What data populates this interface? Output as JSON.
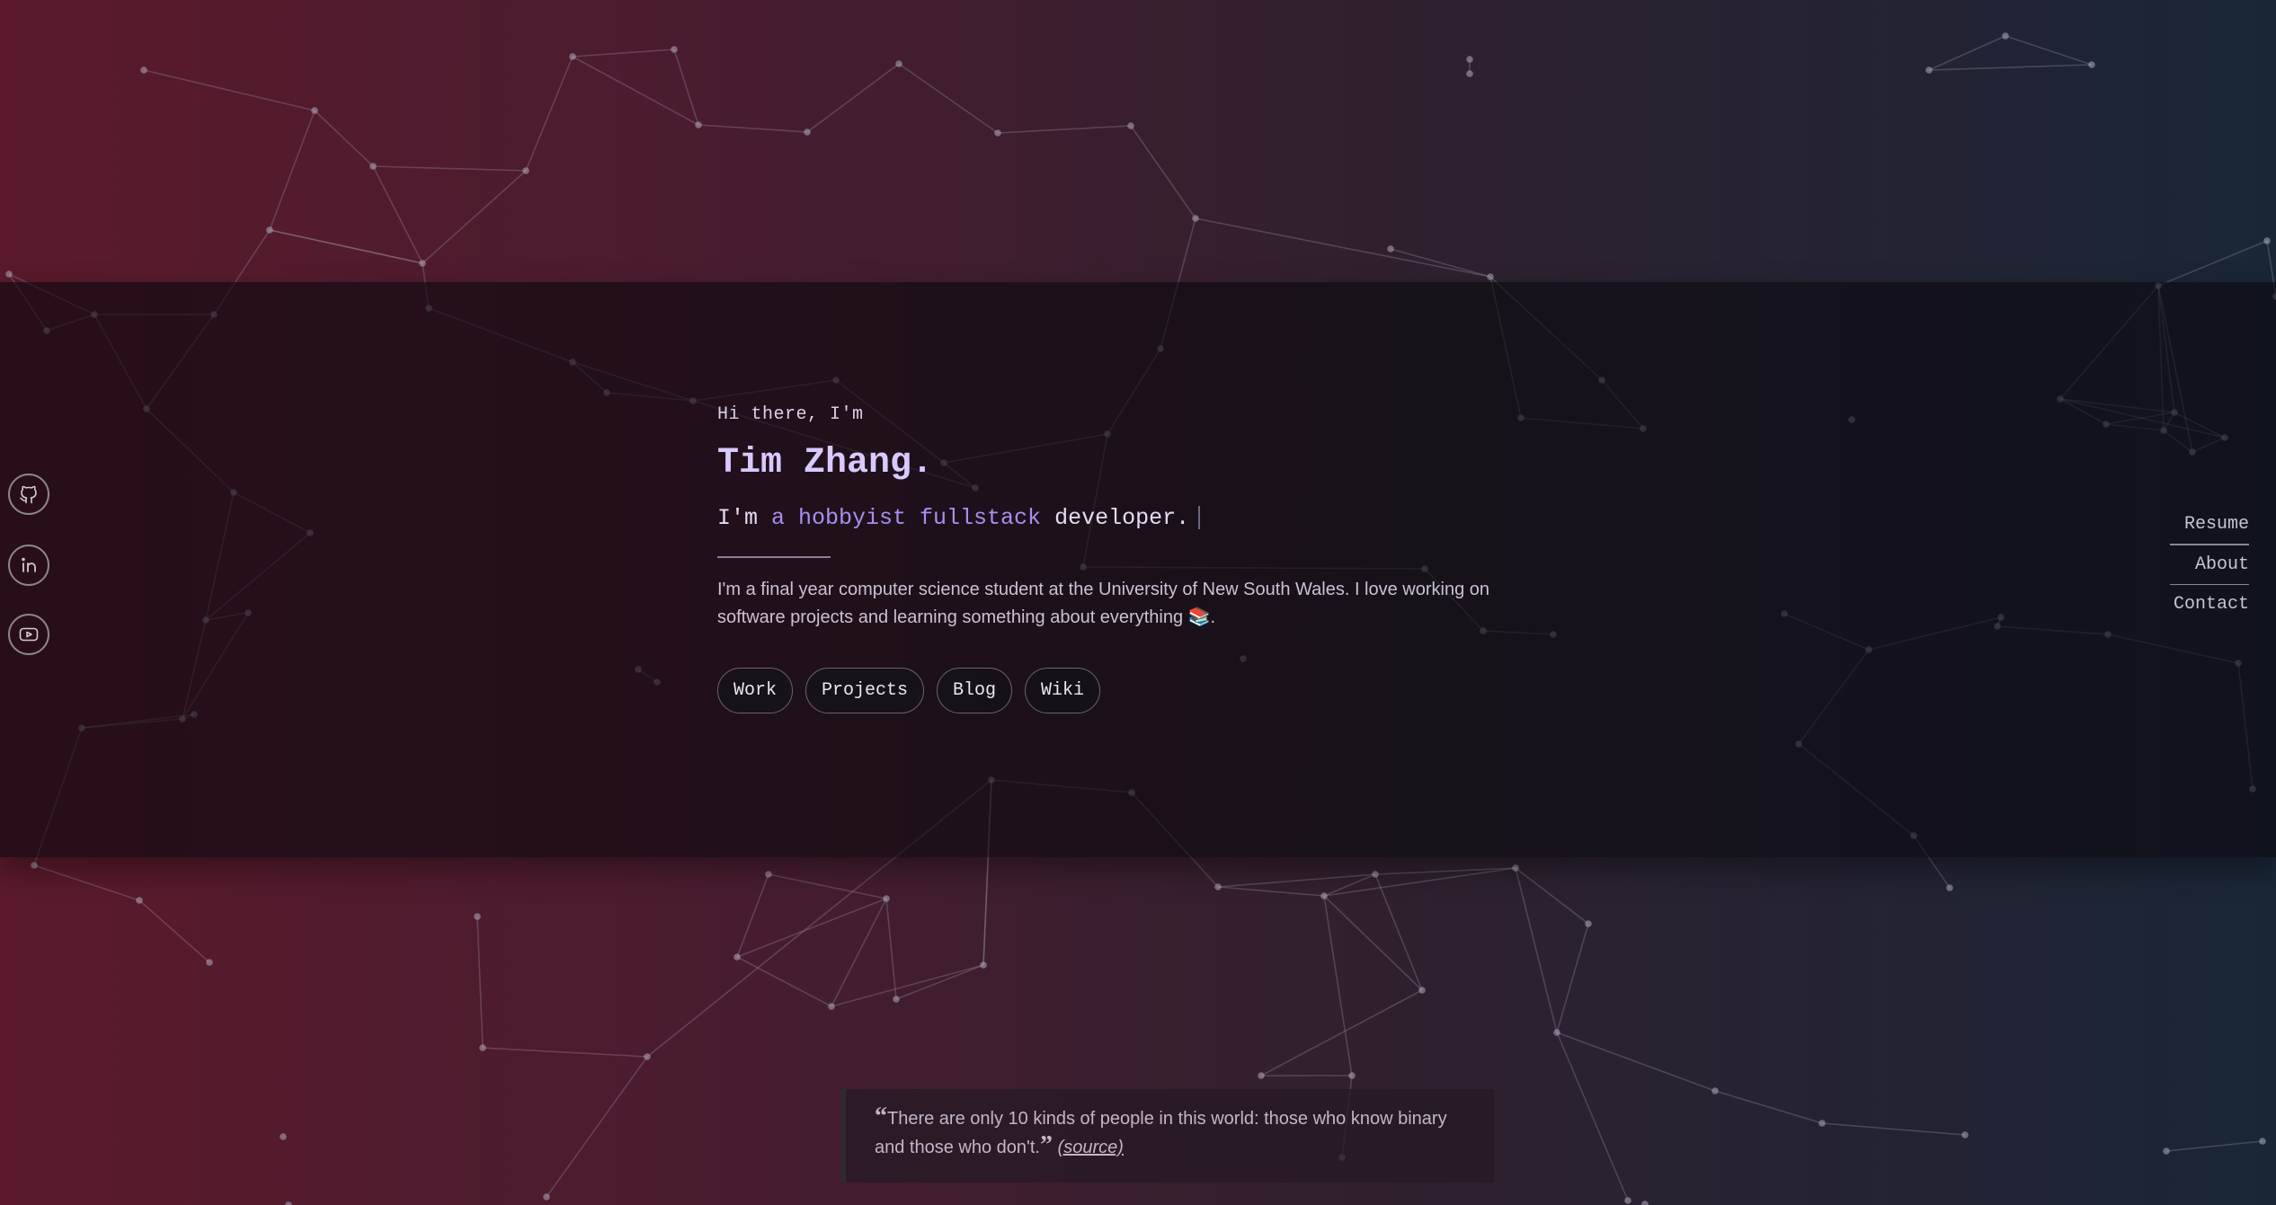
{
  "hero": {
    "greeting": "Hi there, I'm",
    "name": "Tim Zhang.",
    "tagline_prefix": "I'm ",
    "tagline_highlight": "a hobbyist fullstack",
    "tagline_suffix": " developer.",
    "bio": "I'm a final year computer science student at the University of New South Wales. I love working on software projects and learning something about everything 📚."
  },
  "links": [
    {
      "label": "Work"
    },
    {
      "label": "Projects"
    },
    {
      "label": "Blog"
    },
    {
      "label": "Wiki"
    }
  ],
  "right_nav": [
    {
      "label": "Resume"
    },
    {
      "label": "About"
    },
    {
      "label": "Contact"
    }
  ],
  "social": [
    {
      "icon": "github-icon"
    },
    {
      "icon": "linkedin-icon"
    },
    {
      "icon": "youtube-icon"
    }
  ],
  "quote": {
    "open_mark": "“",
    "text": "There are only 10 kinds of people in this world: those who know binary and those who don't.",
    "close_mark": "”",
    "source_label": "(source)"
  },
  "colors": {
    "accent": "#a690f0",
    "name": "#d8c9ff"
  }
}
